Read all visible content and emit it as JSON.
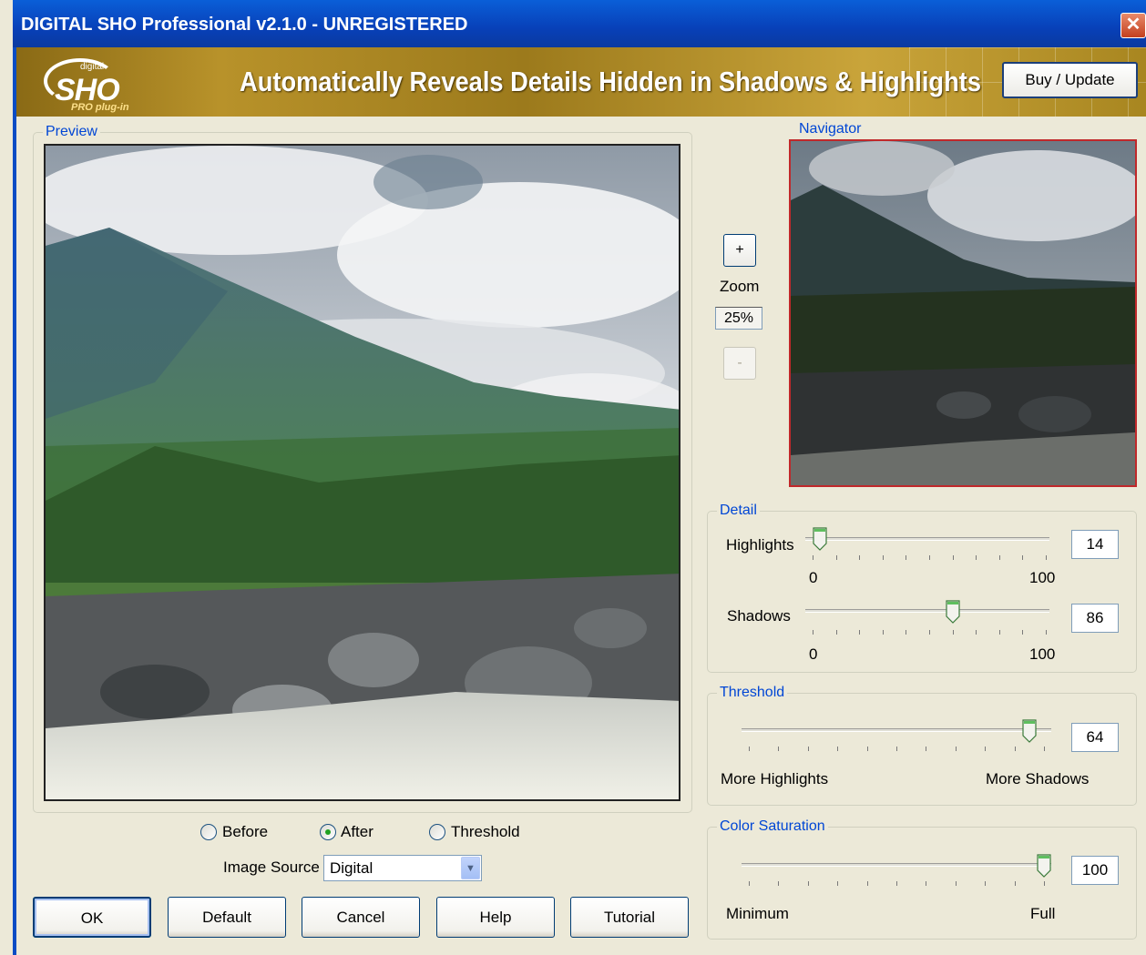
{
  "window": {
    "title": "DIGITAL SHO Professional  v2.1.0 - UNREGISTERED",
    "close_glyph": "✕"
  },
  "banner": {
    "logo_digital": "digital",
    "logo_sho": "SHO",
    "logo_plugin": "PRO plug-in",
    "tagline": "Automatically Reveals Details Hidden in Shadows & Highlights",
    "buy_label": "Buy / Update"
  },
  "preview": {
    "legend": "Preview"
  },
  "navigator": {
    "legend": "Navigator"
  },
  "zoom": {
    "plus": "+",
    "label": "Zoom",
    "value": "25%",
    "minus": "-"
  },
  "detail": {
    "legend": "Detail",
    "highlights": {
      "label": "Highlights",
      "value": "14",
      "min": "0",
      "max": "100",
      "level": 0.03
    },
    "shadows": {
      "label": "Shadows",
      "value": "86",
      "min": "0",
      "max": "100",
      "level": 0.6
    }
  },
  "threshold": {
    "legend": "Threshold",
    "value": "64",
    "left_label": "More Highlights",
    "right_label": "More Shadows",
    "level": 0.95
  },
  "color_saturation": {
    "legend": "Color Saturation",
    "value": "100",
    "left_label": "Minimum",
    "right_label": "Full",
    "level": 1.0
  },
  "view_mode": {
    "options": [
      "Before",
      "After",
      "Threshold"
    ],
    "selected": "After"
  },
  "image_source": {
    "label": "Image Source",
    "value": "Digital"
  },
  "buttons": {
    "ok": "OK",
    "default": "Default",
    "cancel": "Cancel",
    "help": "Help",
    "tutorial": "Tutorial"
  },
  "colors": {
    "accent": "#0046d5",
    "titlebar": "#0a50cc",
    "banner_gold": "#b8922a",
    "nav_border": "#c0282a"
  }
}
